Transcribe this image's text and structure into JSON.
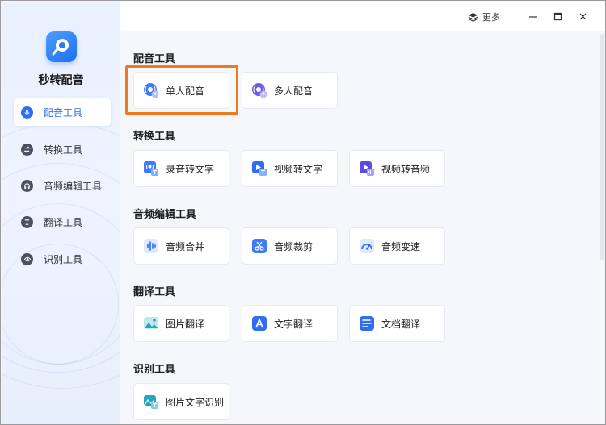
{
  "app": {
    "name": "秒转配音"
  },
  "titlebar": {
    "more_label": "更多"
  },
  "sidebar": {
    "items": [
      {
        "label": "配音工具",
        "icon": "microphone-icon",
        "active": true
      },
      {
        "label": "转换工具",
        "icon": "convert-icon",
        "active": false
      },
      {
        "label": "音频编辑工具",
        "icon": "headphones-icon",
        "active": false
      },
      {
        "label": "翻译工具",
        "icon": "translate-icon",
        "active": false
      },
      {
        "label": "识别工具",
        "icon": "eye-icon",
        "active": false
      }
    ]
  },
  "sections": [
    {
      "title": "配音工具",
      "cards": [
        {
          "label": "单人配音",
          "icon": "single-voice-icon",
          "highlighted": true
        },
        {
          "label": "多人配音",
          "icon": "multi-voice-icon"
        }
      ]
    },
    {
      "title": "转换工具",
      "cards": [
        {
          "label": "录音转文字",
          "icon": "recording-to-text-icon"
        },
        {
          "label": "视频转文字",
          "icon": "video-to-text-icon"
        },
        {
          "label": "视频转音频",
          "icon": "video-to-audio-icon"
        }
      ]
    },
    {
      "title": "音频编辑工具",
      "cards": [
        {
          "label": "音频合并",
          "icon": "audio-merge-icon"
        },
        {
          "label": "音频裁剪",
          "icon": "audio-cut-icon"
        },
        {
          "label": "音频变速",
          "icon": "audio-speed-icon"
        }
      ]
    },
    {
      "title": "翻译工具",
      "cards": [
        {
          "label": "图片翻译",
          "icon": "image-translate-icon"
        },
        {
          "label": "文字翻译",
          "icon": "text-translate-icon"
        },
        {
          "label": "文档翻译",
          "icon": "document-translate-icon"
        }
      ]
    },
    {
      "title": "识别工具",
      "cards": [
        {
          "label": "图片文字识别",
          "icon": "image-ocr-icon"
        }
      ]
    }
  ],
  "colors": {
    "accent": "#2d6ff3",
    "highlight": "#f07a1e",
    "sidebar_bg": "#eaf1ff",
    "content_bg": "#f5f7fb"
  }
}
